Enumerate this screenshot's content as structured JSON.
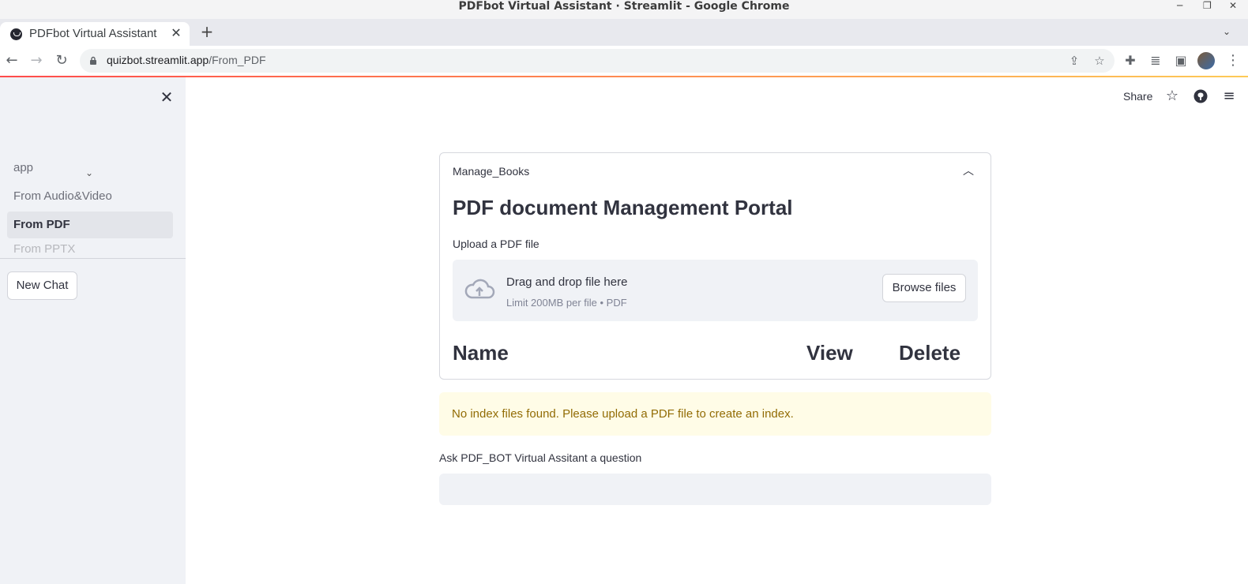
{
  "window": {
    "title": "PDFbot Virtual Assistant · Streamlit - Google Chrome",
    "controls": [
      "minimize-icon",
      "restore-icon",
      "close-icon"
    ]
  },
  "tabs": [
    {
      "title": "PDFbot Virtual Assistant",
      "favicon": "streamlit-icon"
    }
  ],
  "toolbar": {
    "url_host": "quizbot.streamlit.app",
    "url_path": "/From_PDF",
    "icons": [
      "back-icon",
      "forward-icon",
      "reload-icon",
      "lock-icon",
      "share-icon",
      "bookmark-star-icon",
      "extensions-icon",
      "media-icon",
      "sidepanel-icon",
      "profile-avatar",
      "menu-icon"
    ]
  },
  "sidebar": {
    "nav": [
      {
        "label": "app"
      },
      {
        "label": "From Audio&Video"
      },
      {
        "label": "From PDF",
        "active": true
      },
      {
        "label": "From PPTX"
      }
    ],
    "new_chat_label": "New Chat"
  },
  "header": {
    "share_label": "Share"
  },
  "expander": {
    "title": "Manage_Books",
    "heading": "PDF document Management Portal",
    "upload_label": "Upload a PDF file",
    "dropzone_main": "Drag and drop file here",
    "dropzone_sub": "Limit 200MB per file • PDF",
    "browse_label": "Browse files",
    "columns": [
      "Name",
      "View",
      "Delete"
    ]
  },
  "warning": {
    "text": "No index files found. Please upload a PDF file to create an index.",
    "color": "#926c05",
    "background": "#fffce7"
  },
  "ask": {
    "label": "Ask PDF_BOT Virtual Assitant a question",
    "value": ""
  },
  "colors": {
    "accent": "#ff4b4b",
    "sidebar_bg": "#f0f2f6",
    "text": "#31333f"
  }
}
